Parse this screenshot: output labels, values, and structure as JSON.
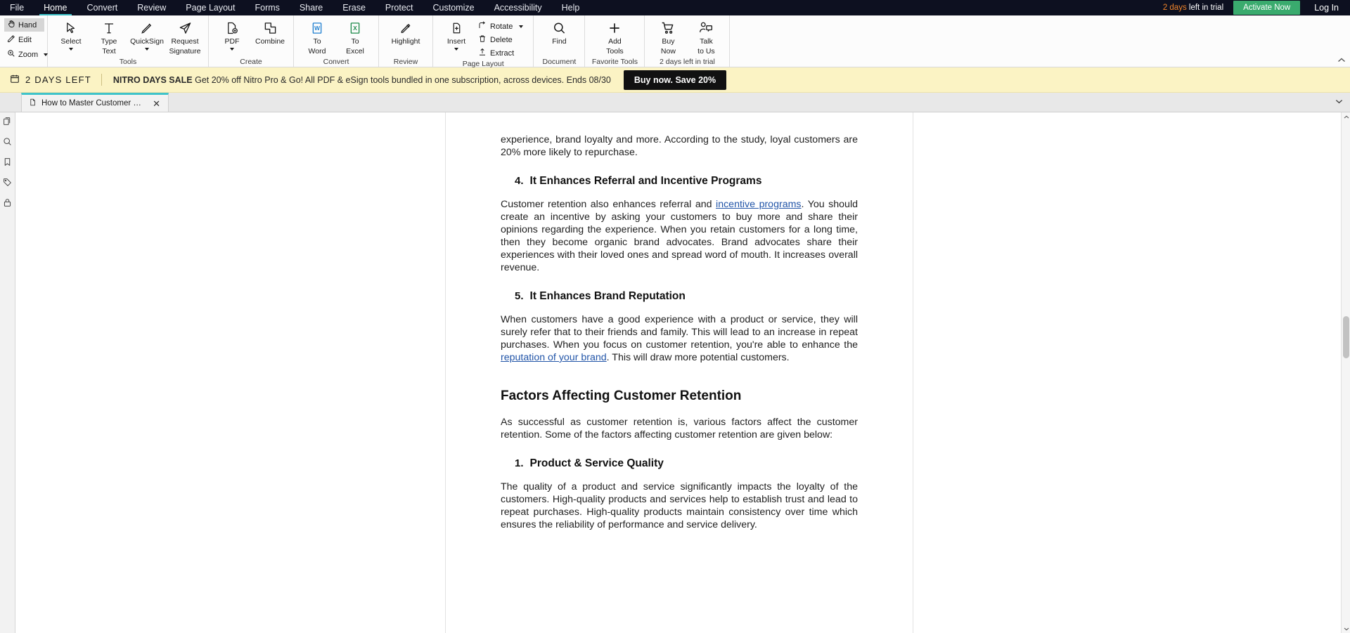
{
  "menubar": {
    "items": [
      {
        "label": "File",
        "active": false
      },
      {
        "label": "Home",
        "active": true
      },
      {
        "label": "Convert",
        "active": false
      },
      {
        "label": "Review",
        "active": false
      },
      {
        "label": "Page Layout",
        "active": false
      },
      {
        "label": "Forms",
        "active": false
      },
      {
        "label": "Share",
        "active": false
      },
      {
        "label": "Erase",
        "active": false
      },
      {
        "label": "Protect",
        "active": false
      },
      {
        "label": "Customize",
        "active": false
      },
      {
        "label": "Accessibility",
        "active": false
      },
      {
        "label": "Help",
        "active": false
      }
    ],
    "trial_days": "2 days",
    "trial_suffix": "left in trial",
    "activate_label": "Activate Now",
    "login_label": "Log In",
    "accent_green": "#3aab6e",
    "accent_orange": "#f0842a",
    "bar_bg": "#0d1020"
  },
  "ribbon": {
    "modes": [
      {
        "label": "Hand",
        "icon": "hand-icon",
        "selected": true
      },
      {
        "label": "Edit",
        "icon": "edit-icon",
        "selected": false
      },
      {
        "label": "Zoom",
        "icon": "zoom-icon",
        "selected": false,
        "has_caret": true
      }
    ],
    "groups": [
      {
        "label": "Tools",
        "tools": [
          {
            "label_line1": "Select",
            "label_line2": "",
            "icon": "cursor-icon",
            "caret": true
          },
          {
            "label_line1": "Type",
            "label_line2": "Text",
            "icon": "text-icon",
            "caret": false
          },
          {
            "label_line1": "QuickSign",
            "label_line2": "",
            "icon": "pen-icon",
            "caret": true
          },
          {
            "label_line1": "Request",
            "label_line2": "Signature",
            "icon": "send-icon",
            "caret": false
          }
        ]
      },
      {
        "label": "Create",
        "tools": [
          {
            "label_line1": "PDF",
            "label_line2": "",
            "icon": "pdf-add-icon",
            "caret": true
          },
          {
            "label_line1": "Combine",
            "label_line2": "",
            "icon": "combine-icon",
            "caret": false
          }
        ]
      },
      {
        "label": "Convert",
        "tools": [
          {
            "label_line1": "To",
            "label_line2": "Word",
            "icon": "word-icon",
            "caret": false
          },
          {
            "label_line1": "To",
            "label_line2": "Excel",
            "icon": "excel-icon",
            "caret": false
          }
        ]
      },
      {
        "label": "Review",
        "tools": [
          {
            "label_line1": "Highlight",
            "label_line2": "",
            "icon": "highlighter-icon",
            "caret": false
          }
        ]
      },
      {
        "label": "Page Layout",
        "tools": [
          {
            "label_line1": "Insert",
            "label_line2": "",
            "icon": "page-insert-icon",
            "caret": true
          }
        ],
        "stack": [
          {
            "label": "Rotate",
            "icon": "rotate-icon",
            "caret": true
          },
          {
            "label": "Delete",
            "icon": "trash-icon",
            "caret": false
          },
          {
            "label": "Extract",
            "icon": "extract-icon",
            "caret": false
          }
        ]
      },
      {
        "label": "Document",
        "tools": [
          {
            "label_line1": "Find",
            "label_line2": "",
            "icon": "search-icon",
            "caret": false
          }
        ]
      },
      {
        "label": "Favorite Tools",
        "tools": [
          {
            "label_line1": "Add",
            "label_line2": "Tools",
            "icon": "plus-icon",
            "caret": false
          }
        ]
      },
      {
        "label": "2 days left in trial",
        "tools": [
          {
            "label_line1": "Buy",
            "label_line2": "Now",
            "icon": "cart-icon",
            "caret": false
          },
          {
            "label_line1": "Talk",
            "label_line2": "to Us",
            "icon": "talk-icon",
            "caret": false
          }
        ]
      }
    ],
    "collapse_icon": "chevron-up-icon"
  },
  "promo": {
    "days_badge": "2 DAYS LEFT",
    "calendar_icon": "calendar-icon",
    "headline": "NITRO DAYS SALE",
    "message": " Get 20% off Nitro Pro & Go! All PDF & eSign tools bundled in one subscription, across devices. Ends 08/30",
    "cta_label": "Buy now. Save 20%",
    "bg": "#fbf3c4"
  },
  "tabstrip": {
    "tab_title": "How to Master Customer Retention ...",
    "tab_icon": "document-icon",
    "close_icon": "close-icon",
    "overflow_icon": "chevron-down-icon",
    "accent": "#3fc3c9"
  },
  "leftrail": {
    "items": [
      {
        "name": "pages-panel-icon"
      },
      {
        "name": "search-panel-icon"
      },
      {
        "name": "bookmarks-panel-icon"
      },
      {
        "name": "tags-panel-icon"
      },
      {
        "name": "security-panel-icon"
      }
    ]
  },
  "document": {
    "para_top": "experience, brand loyalty and more. According to the study, loyal customers are 20% more likely to repurchase.",
    "heading4_num": "4.",
    "heading4_text": "It Enhances Referral and Incentive Programs",
    "para4_a": "Customer retention also enhances referral and ",
    "para4_link": "incentive programs",
    "para4_b": ". You should create an incentive by asking your customers to buy more and share their opinions regarding the experience. When you retain customers for a long time, then they become organic brand advocates. Brand advocates share their experiences with their loved ones and spread word of mouth. It increases overall revenue.",
    "heading5_num": "5.",
    "heading5_text": "It Enhances Brand Reputation",
    "para5_a": "When customers have a good experience with a product or service, they will surely refer that to their friends and family. This will lead to an increase in repeat purchases. When you focus on customer retention, you're able to enhance the ",
    "para5_link": "reputation of your brand",
    "para5_b": ". This will draw more potential customers.",
    "section_heading": "Factors Affecting Customer Retention",
    "para_factors": "As successful as customer retention is, various factors affect the customer retention. Some of the factors affecting customer retention are given below:",
    "heading1_num": "1.",
    "heading1_text": "Product & Service Quality",
    "para1": "The quality of a product and service significantly impacts the loyalty of the customers. High-quality products and services help to establish trust and lead to repeat purchases. High-quality products maintain consistency over time which ensures the reliability of performance and service delivery."
  }
}
